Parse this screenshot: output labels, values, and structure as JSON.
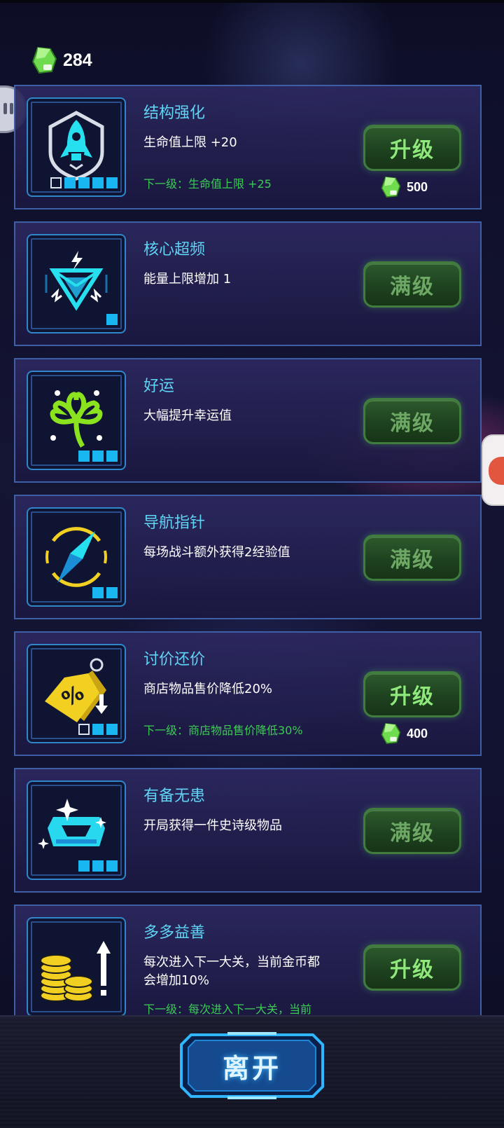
{
  "currency": {
    "gems": "284",
    "gem_icon": "green-gem-icon"
  },
  "items": [
    {
      "title": "结构强化",
      "desc": "生命值上限 +20",
      "next": "下一级：生命值上限 +25",
      "button": "升级",
      "state": "upgrade",
      "cost": "500",
      "level": 4,
      "max_level": 5,
      "icon": "rocket-shield-icon"
    },
    {
      "title": "核心超频",
      "desc": "能量上限增加 1",
      "next": "",
      "button": "满级",
      "state": "max",
      "cost": "",
      "level": 1,
      "max_level": 1,
      "icon": "lightning-core-icon"
    },
    {
      "title": "好运",
      "desc": "大幅提升幸运值",
      "next": "",
      "button": "满级",
      "state": "max",
      "cost": "",
      "level": 3,
      "max_level": 3,
      "icon": "clover-icon"
    },
    {
      "title": "导航指针",
      "desc": "每场战斗额外获得2经验值",
      "next": "",
      "button": "满级",
      "state": "max",
      "cost": "",
      "level": 2,
      "max_level": 2,
      "icon": "compass-icon"
    },
    {
      "title": "讨价还价",
      "desc": "商店物品售价降低20%",
      "next": "下一级：商店物品售价降低30%",
      "button": "升级",
      "state": "upgrade",
      "cost": "400",
      "level": 2,
      "max_level": 3,
      "icon": "price-tag-icon"
    },
    {
      "title": "有备无患",
      "desc": "开局获得一件史诗级物品",
      "next": "",
      "button": "满级",
      "state": "max",
      "cost": "",
      "level": 3,
      "max_level": 3,
      "icon": "chest-icon"
    },
    {
      "title": "多多益善",
      "desc": "每次进入下一大关，当前金币都\n会增加10%",
      "next": "下一级：每次进入下一大关，当前",
      "button": "升级",
      "state": "upgrade",
      "cost": "",
      "level": 0,
      "max_level": 0,
      "icon": "gold-coins-icon"
    }
  ],
  "footer": {
    "leave_label": "离开"
  },
  "colors": {
    "title": "#5fd4f4",
    "next_level": "#3ccb55",
    "pip_on": "#19b7f2",
    "button_text_upgrade": "#8fe87c",
    "button_text_max": "#6ea865"
  }
}
